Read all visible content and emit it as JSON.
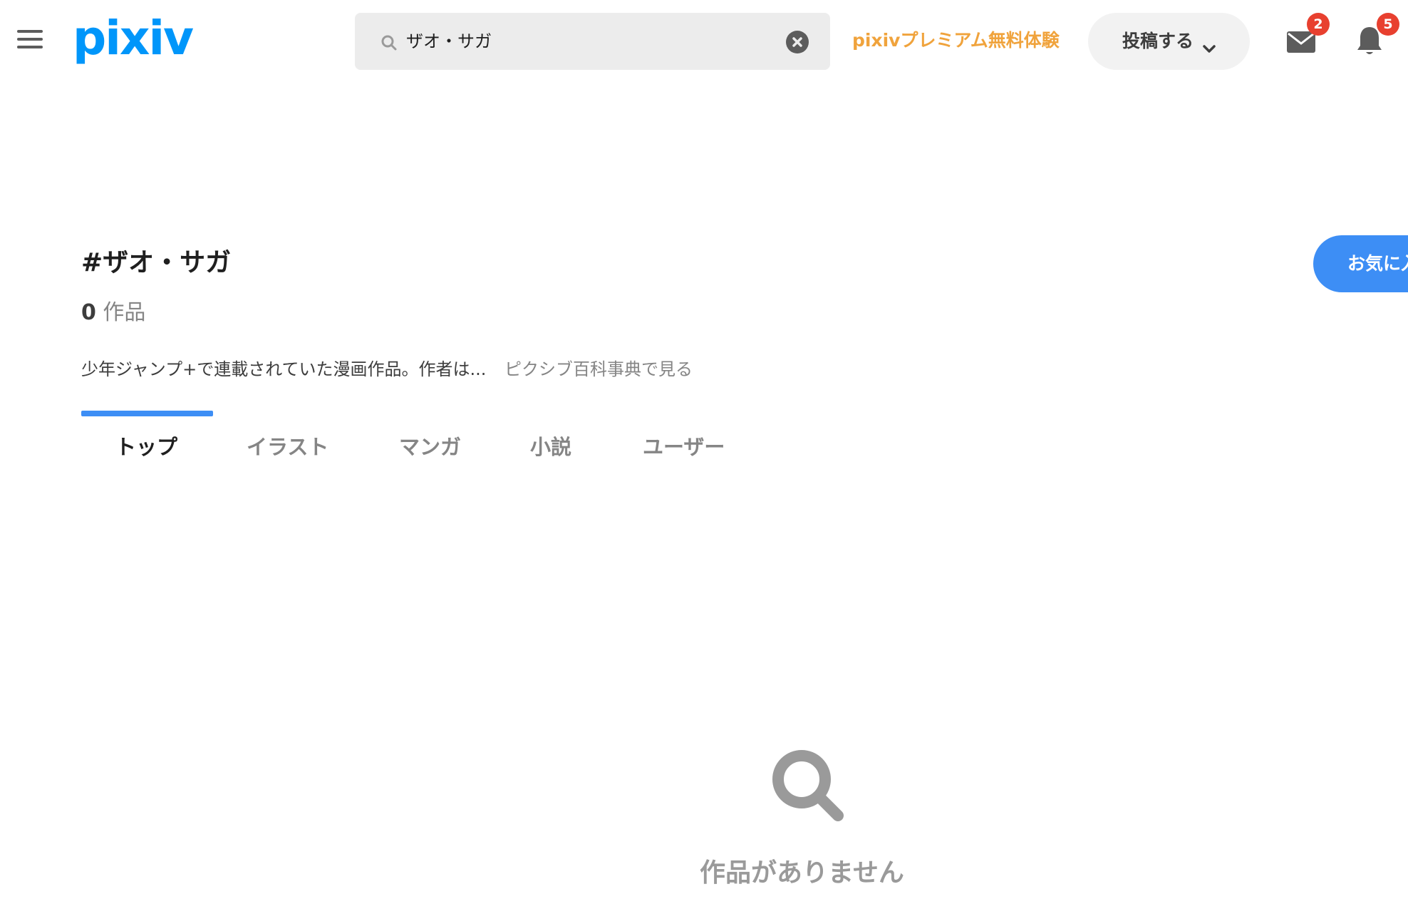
{
  "header": {
    "logo": "pixiv",
    "search": {
      "query": "ザオ・サガ"
    },
    "premium_link": "pixivプレミアム無料体験",
    "post_button": "投稿する",
    "messages_badge": "2",
    "notifications_badge": "5"
  },
  "tag": {
    "title": "#ザオ・サガ",
    "count": "0",
    "count_unit": "作品",
    "description": "少年ジャンプ+で連載されていた漫画作品。作者は...",
    "pixiv_encyclopedia_link": "ピクシブ百科事典で見る",
    "favorite_button": "お気に入"
  },
  "tabs": [
    {
      "label": "トップ",
      "active": true
    },
    {
      "label": "イラスト",
      "active": false
    },
    {
      "label": "マンガ",
      "active": false
    },
    {
      "label": "小説",
      "active": false
    },
    {
      "label": "ユーザー",
      "active": false
    }
  ],
  "empty_state": {
    "message": "作品がありません",
    "icon": "search-icon"
  },
  "colors": {
    "brand": "#0096fa",
    "premium": "#f0a33c",
    "accent": "#3d8ef5",
    "badge": "#e8402f"
  }
}
